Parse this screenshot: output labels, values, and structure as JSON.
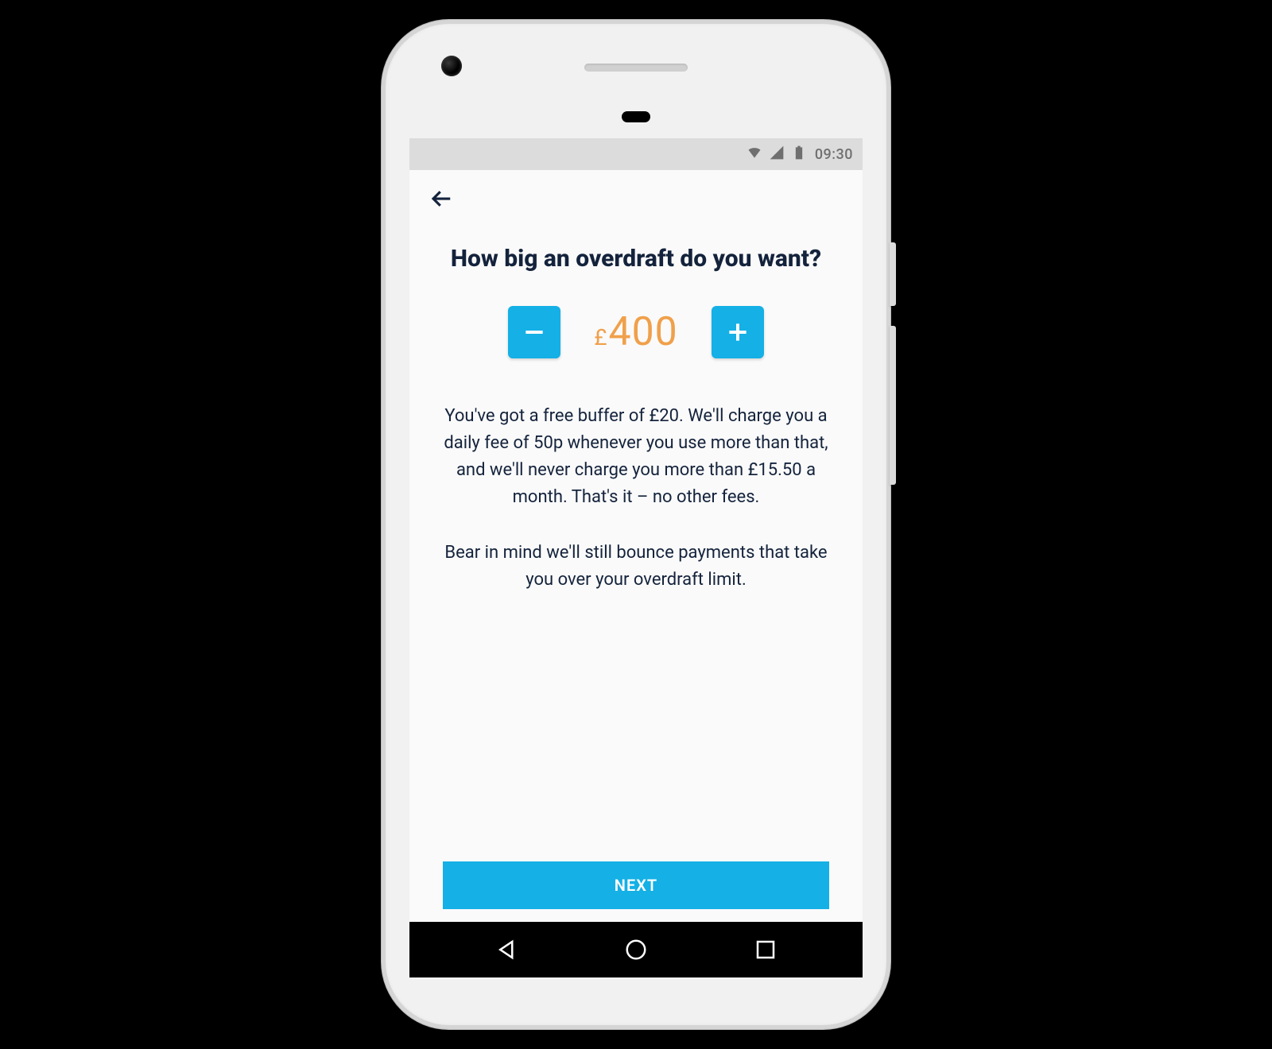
{
  "status_bar": {
    "time": "09:30"
  },
  "screen": {
    "heading": "How big an overdraft do you want?",
    "amount": {
      "currency": "£",
      "value": "400"
    },
    "paragraph1": "You've got a free buffer of £20. We'll charge you a daily fee of 50p whenever you use more than that, and we'll never charge you more than £15.50 a month. That's it – no other fees.",
    "paragraph2": "Bear in mind we'll still bounce payments that take you over your overdraft limit.",
    "cta_label": "NEXT"
  },
  "colors": {
    "accent": "#14b0e6",
    "amount": "#f0a04b",
    "text_dark": "#14233c"
  }
}
